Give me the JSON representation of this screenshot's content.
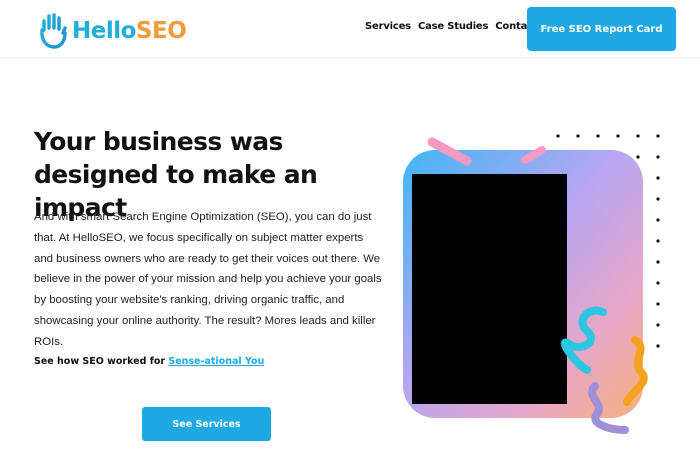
{
  "header": {
    "logo": {
      "hello": "Hello",
      "seo": "SEO",
      "icon": "hand-icon"
    },
    "nav": [
      {
        "label": "Services"
      },
      {
        "label": "Case Studies"
      },
      {
        "label": "Contact"
      }
    ],
    "cta_label": "Free SEO Report Card"
  },
  "hero": {
    "headline": "Your business was designed to make an impact",
    "body": "And with smart Search Engine Optimization (SEO), you can do just that. At HelloSEO, we focus specifically on subject matter experts and business owners who are ready to get their voices out there. We believe in the power of your mission and help you achieve your goals by boosting your website's ranking, driving organic traffic, and showcasing your online authority. The result? Mores leads and killer ROIs.",
    "see_how_prefix": "See how SEO worked for ",
    "see_how_link": "Sense-ational You",
    "cta_label": "See Services"
  },
  "colors": {
    "accent": "#1ea9e2",
    "logo_blue": "#1fb0d8",
    "logo_orange": "#f49a3c"
  }
}
